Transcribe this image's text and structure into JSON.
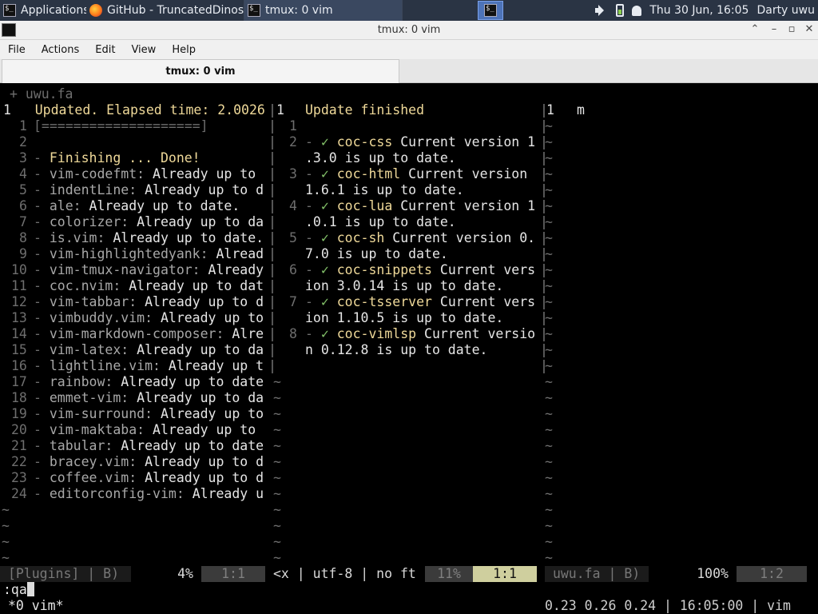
{
  "panel": {
    "apps_label": "Applications ☰",
    "tasks": [
      "GitHub - TruncatedDinos...",
      "tmux: 0 vim"
    ],
    "clock": "Thu 30 Jun, 16:05",
    "user": "Darty uwu"
  },
  "window": {
    "title": "tmux: 0 vim",
    "menus": [
      "File",
      "Actions",
      "Edit",
      "View",
      "Help"
    ],
    "tab": "tmux: 0 vim"
  },
  "vim": {
    "bufname": "+ uwu.fa",
    "left": {
      "l1_num": "1",
      "l1_text": "Updated. Elapsed time: 2.0026",
      "l1_rnum": "1",
      "l2_text": "[====================]",
      "l3_num": "2",
      "l4_num": "3",
      "l4_text": "Finishing ... Done!",
      "plugins": [
        {
          "n": "4",
          "name": "vim-codefmt:",
          "rest": " Already up to "
        },
        {
          "n": "5",
          "name": "indentLine:",
          "rest": " Already up to d"
        },
        {
          "n": "6",
          "name": "ale:",
          "rest": " Already up to date."
        },
        {
          "n": "7",
          "name": "colorizer:",
          "rest": " Already up to da"
        },
        {
          "n": "8",
          "name": "is.vim:",
          "rest": " Already up to date."
        },
        {
          "n": "9",
          "name": "vim-highlightedyank:",
          "rest": " Alread"
        },
        {
          "n": "10",
          "name": "vim-tmux-navigator:",
          "rest": " Already"
        },
        {
          "n": "11",
          "name": "coc.nvim:",
          "rest": " Already up to dat"
        },
        {
          "n": "12",
          "name": "vim-tabbar:",
          "rest": " Already up to d"
        },
        {
          "n": "13",
          "name": "vimbuddy.vim:",
          "rest": " Already up to"
        },
        {
          "n": "14",
          "name": "vim-markdown-composer:",
          "rest": " Alre"
        },
        {
          "n": "15",
          "name": "vim-latex:",
          "rest": " Already up to da"
        },
        {
          "n": "16",
          "name": "lightline.vim:",
          "rest": " Already up t"
        },
        {
          "n": "17",
          "name": "rainbow:",
          "rest": " Already up to date"
        },
        {
          "n": "18",
          "name": "emmet-vim:",
          "rest": " Already up to da"
        },
        {
          "n": "19",
          "name": "vim-surround:",
          "rest": " Already up to"
        },
        {
          "n": "20",
          "name": "vim-maktaba:",
          "rest": " Already up to "
        },
        {
          "n": "21",
          "name": "tabular:",
          "rest": " Already up to date"
        },
        {
          "n": "22",
          "name": "bracey.vim:",
          "rest": " Already up to d"
        },
        {
          "n": "23",
          "name": "coffee.vim:",
          "rest": " Already up to d"
        },
        {
          "n": "24",
          "name": "editorconfig-vim:",
          "rest": " Already u"
        }
      ],
      "tilde": "~"
    },
    "middle": {
      "title": "Update finished",
      "blank_num": "1",
      "items": [
        {
          "n": "2",
          "name": "coc-css",
          "rest": " Current version 1",
          "cont": ".3.0 is up to date."
        },
        {
          "n": "3",
          "name": "coc-html",
          "rest": " Current version ",
          "cont": "1.6.1 is up to date."
        },
        {
          "n": "4",
          "name": "coc-lua",
          "rest": " Current version 1",
          "cont": ".0.1 is up to date."
        },
        {
          "n": "5",
          "name": "coc-sh",
          "rest": " Current version 0.",
          "cont": "7.0 is up to date."
        },
        {
          "n": "6",
          "name": "coc-snippets",
          "rest": " Current vers",
          "cont": "ion 3.0.14 is up to date."
        },
        {
          "n": "7",
          "name": "coc-tsserver",
          "rest": " Current vers",
          "cont": "ion 1.10.5 is up to date."
        },
        {
          "n": "8",
          "name": "coc-vimlsp",
          "rest": " Current versio",
          "cont": "n 0.12.8 is up to date."
        }
      ],
      "bullet": "- ✓"
    },
    "right": {
      "l1_num": "1",
      "l1_text": "m"
    },
    "status": {
      "left_name": "[Plugins] | B)",
      "left_pct": "4%",
      "left_pos": "1:1",
      "mid_info": "<x | utf-8 | no ft",
      "mid_pct": "11%",
      "mid_pos": "1:1",
      "right_name": "uwu.fa | B)",
      "right_pct": "100%",
      "right_pos": "1:2"
    },
    "cmdline": ":qa"
  },
  "tmux": {
    "window_label": "*0 vim*",
    "right_status": "0.23 0.26 0.24 | 16:05:00 | vim"
  }
}
